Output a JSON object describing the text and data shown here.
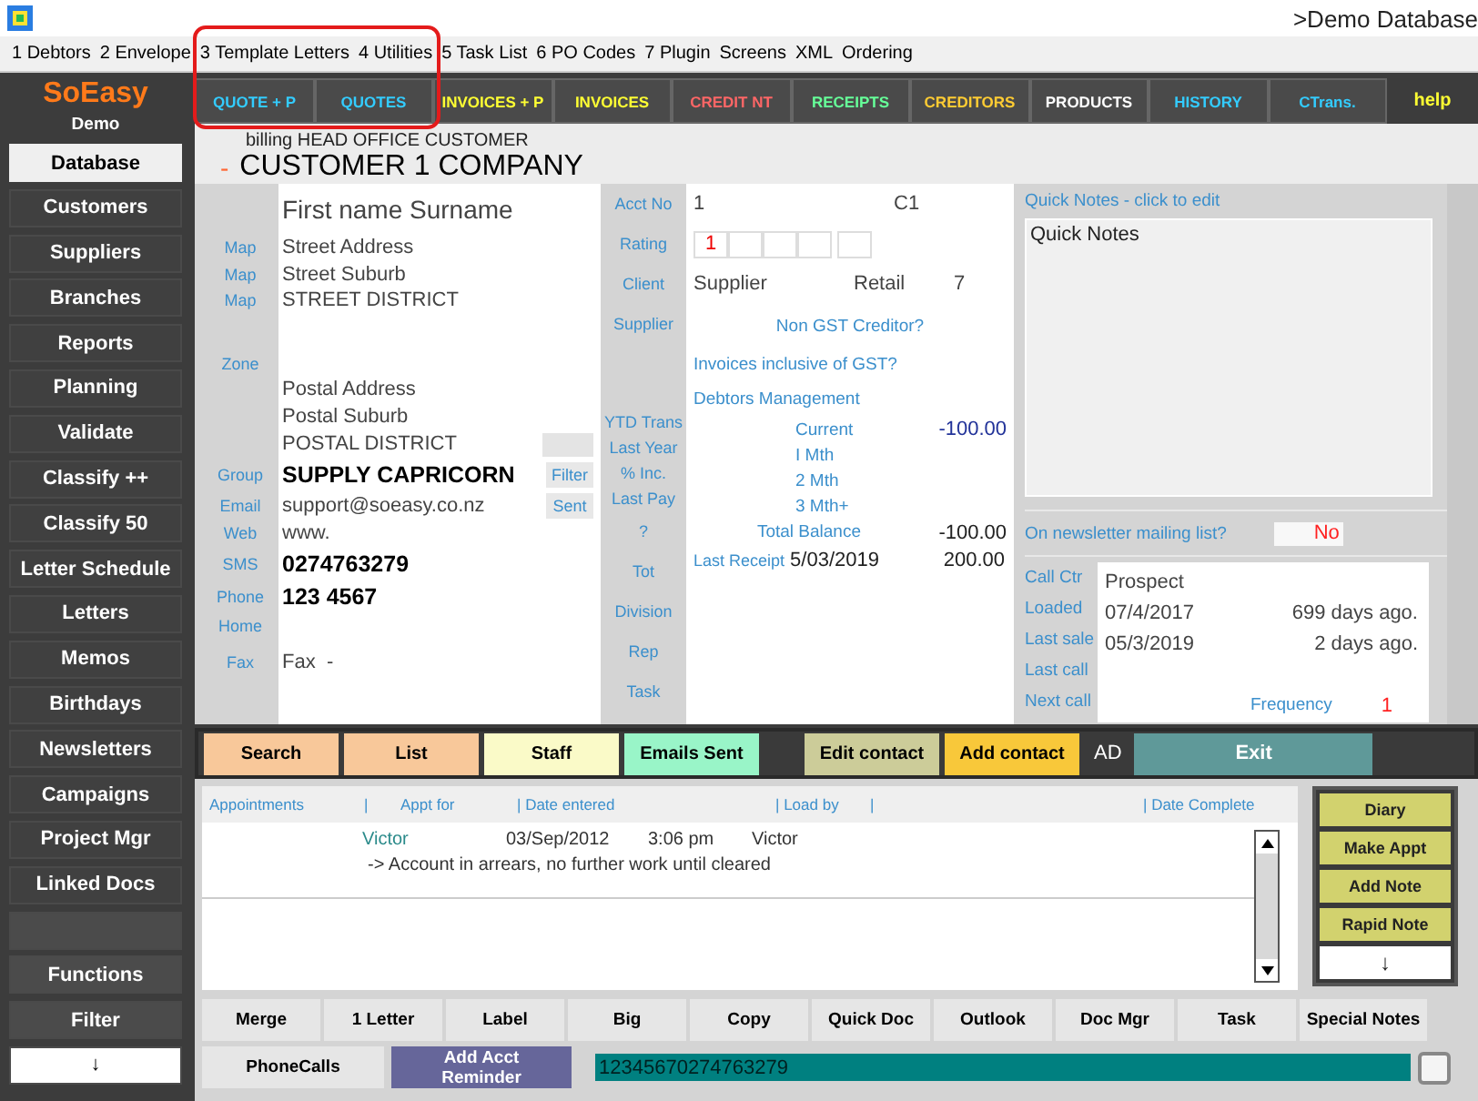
{
  "window": {
    "title": ">Demo Database"
  },
  "menu": [
    "1 Debtors",
    "2 Envelope",
    "3 Template Letters",
    "4 Utilities",
    "5 Task List",
    "6 PO Codes",
    "7 Plugin",
    "Screens",
    "XML",
    "Ordering"
  ],
  "logo": {
    "name": "SoEasy",
    "subtitle": "Demo"
  },
  "sidebar": [
    {
      "kind": "item",
      "label": "Database",
      "selected": true
    },
    {
      "kind": "item",
      "label": "Customers",
      "selected": false
    },
    {
      "kind": "item",
      "label": "Suppliers",
      "selected": false
    },
    {
      "kind": "item",
      "label": "Branches",
      "selected": false
    },
    {
      "kind": "item",
      "label": "Reports",
      "selected": false
    },
    {
      "kind": "item",
      "label": "Planning",
      "selected": false
    },
    {
      "kind": "item",
      "label": "Validate",
      "selected": false
    },
    {
      "kind": "item",
      "label": "Classify ++",
      "selected": false
    },
    {
      "kind": "item",
      "label": "Classify 50",
      "selected": false
    },
    {
      "kind": "item",
      "label": "Letter Schedule",
      "selected": false
    },
    {
      "kind": "item",
      "label": "Letters",
      "selected": false
    },
    {
      "kind": "item",
      "label": "Memos",
      "selected": false
    },
    {
      "kind": "item",
      "label": "Birthdays",
      "selected": false
    },
    {
      "kind": "item",
      "label": "Newsletters",
      "selected": false
    },
    {
      "kind": "item",
      "label": "Campaigns",
      "selected": false
    },
    {
      "kind": "item",
      "label": "Project Mgr",
      "selected": false
    },
    {
      "kind": "item",
      "label": "Linked Docs",
      "selected": false
    },
    {
      "kind": "blank"
    },
    {
      "kind": "tool",
      "label": "Functions",
      "selected": false
    },
    {
      "kind": "tool",
      "label": "Filter",
      "selected": false
    },
    {
      "kind": "arrow",
      "label": "↓",
      "selected": false
    }
  ],
  "tabs": [
    {
      "label": "QUOTE + P",
      "color": "#33ccff"
    },
    {
      "label": "QUOTES",
      "color": "#33ccff"
    },
    {
      "label": "INVOICES + P",
      "color": "#ffff33"
    },
    {
      "label": "INVOICES",
      "color": "#ffff33"
    },
    {
      "label": "CREDIT NT",
      "color": "#ff6666"
    },
    {
      "label": "RECEIPTS",
      "color": "#66ff99"
    },
    {
      "label": "CREDITORS",
      "color": "#ffcc33"
    },
    {
      "label": "PRODUCTS",
      "color": "#ffffff"
    },
    {
      "label": "HISTORY",
      "color": "#33ccff"
    },
    {
      "label": "CTrans.",
      "color": "#33ccff"
    }
  ],
  "help": "help",
  "header": {
    "billing": "billing HEAD OFFICE CUSTOMER",
    "marker": "-",
    "company": "CUSTOMER 1 COMPANY"
  },
  "contact": [
    {
      "kind": "name",
      "value": "First name Surname"
    },
    {
      "kind": "line",
      "label": "Map",
      "value": "Street Address"
    },
    {
      "kind": "line",
      "label": "Map",
      "value": "Street Suburb"
    },
    {
      "kind": "line",
      "label": "Map",
      "value": "STREET DISTRICT"
    },
    {
      "kind": "gap"
    },
    {
      "kind": "line",
      "label": "Zone"
    },
    {
      "kind": "line",
      "value": "Postal Address"
    },
    {
      "kind": "line",
      "value": "Postal Suburb"
    },
    {
      "kind": "box",
      "value": "POSTAL DISTRICT"
    },
    {
      "kind": "strong",
      "label": "Group",
      "value": "SUPPLY CAPRICORN",
      "button": "Filter"
    },
    {
      "kind": "line",
      "label": "Email",
      "value": "support@soeasy.co.nz",
      "button": "Sent"
    },
    {
      "kind": "line",
      "label": "Web",
      "value": "www."
    },
    {
      "kind": "strong",
      "label": "SMS",
      "value": "0274763279"
    },
    {
      "kind": "strong",
      "label": "Phone",
      "value": "123 4567"
    },
    {
      "kind": "line",
      "label": "Home"
    },
    {
      "kind": "fax",
      "label": "Fax",
      "value": "Fax  -"
    }
  ],
  "account_labels": [
    {
      "kind": "row",
      "text": "Acct No"
    },
    {
      "kind": "row",
      "text": "Rating"
    },
    {
      "kind": "row",
      "text": "Client"
    },
    {
      "kind": "row",
      "text": "Supplier"
    },
    {
      "kind": "gap"
    },
    {
      "kind": "compact",
      "text": "YTD Trans"
    },
    {
      "kind": "compact",
      "text": "Last Year"
    },
    {
      "kind": "compact",
      "text": "% Inc."
    },
    {
      "kind": "compact",
      "text": "Last Pay"
    },
    {
      "kind": "row",
      "text": "?"
    },
    {
      "kind": "row",
      "text": "Tot"
    },
    {
      "kind": "row",
      "text": "Division"
    },
    {
      "kind": "row",
      "text": "Rep"
    },
    {
      "kind": "row",
      "text": "Task"
    }
  ],
  "account": {
    "acct_no": "1",
    "code": "C1",
    "rating": "1",
    "type": "Supplier",
    "price_level": "Retail",
    "column_3": "7",
    "links": [
      "Non GST Creditor?",
      "Invoices inclusive of GST?",
      "Debtors Management"
    ],
    "aging": [
      {
        "label": "Current",
        "amount": "-100.00"
      },
      {
        "label": "I Mth"
      },
      {
        "label": "2 Mth"
      },
      {
        "label": "3 Mth+"
      }
    ],
    "total": {
      "label": "Total Balance",
      "amount": "-100.00"
    },
    "last_receipt": {
      "label": "Last Receipt",
      "date": "5/03/2019",
      "amount": "200.00"
    }
  },
  "quick_notes": {
    "title": "Quick Notes - click to edit",
    "text": "Quick Notes"
  },
  "newsletter": {
    "label": "On newsletter mailing list?",
    "value": "No"
  },
  "call_centre": {
    "rows": [
      {
        "label": "Call Ctr",
        "value": "Prospect"
      },
      {
        "label": "Loaded",
        "value": "07/4/2017",
        "note": "699 days ago."
      },
      {
        "label": "Last sale",
        "value": "05/3/2019",
        "note": "2 days ago."
      },
      {
        "label": "Last call"
      },
      {
        "label": "Next call"
      }
    ],
    "frequency_label": "Frequency",
    "frequency": "1"
  },
  "actions": [
    {
      "label": "Search",
      "color": "#f8c89a"
    },
    {
      "label": "List",
      "color": "#f8c89a"
    },
    {
      "label": "Staff",
      "color": "#fafac8"
    },
    {
      "label": "Emails Sent",
      "color": "#99f5c8"
    },
    {
      "label": "Edit contact",
      "color": "#cccc99"
    },
    {
      "label": "Add contact",
      "color": "#f8c83a"
    }
  ],
  "ad": "AD",
  "exit": "Exit",
  "appointments": {
    "columns": [
      "Appointments",
      "|",
      "Appt for",
      "| Date entered",
      "| Load by",
      "|",
      "| Date Complete"
    ],
    "rows": [
      {
        "appt_for": "Victor",
        "date": "03/Sep/2012",
        "time": "3:06 pm",
        "load_by": "Victor",
        "note": "-> Account in arrears, no further work until cleared"
      }
    ]
  },
  "diary_buttons": [
    "Diary",
    "Make Appt",
    "Add Note",
    "Rapid Note"
  ],
  "diary_arrow": "↓",
  "tools": [
    "Merge",
    "1 Letter",
    "Label",
    "Big",
    "Copy",
    "Quick Doc",
    "Outlook",
    "Doc Mgr",
    "Task",
    "Special Notes"
  ],
  "phone_calls": "PhoneCalls",
  "reminder": "Add Acct Reminder",
  "dial_field": "12345670274763279"
}
